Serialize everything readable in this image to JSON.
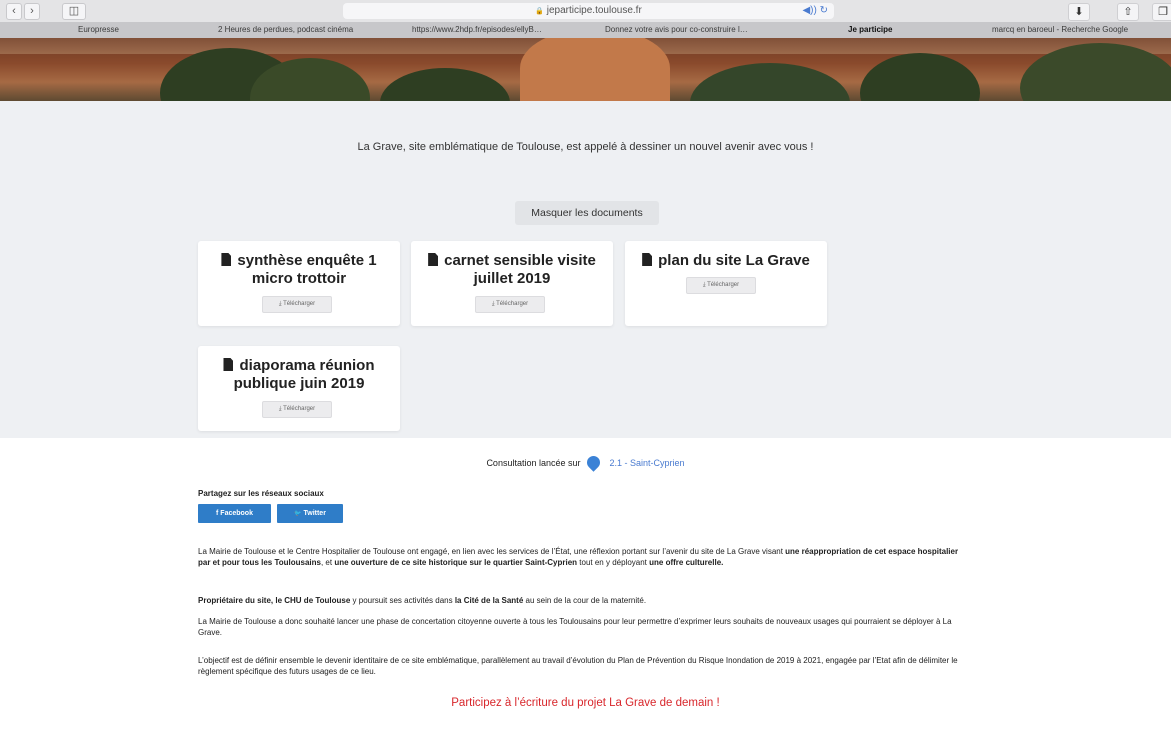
{
  "browser": {
    "nav_back": "‹",
    "nav_forward": "›",
    "sidebar_glyph": "◫",
    "url": "jeparticipe.toulouse.fr",
    "lock_glyph": "🔒",
    "audio_reload": "◀)) ↻",
    "download_glyph": "⬇",
    "share_glyph": "⇧",
    "tabs_glyph": "❐"
  },
  "favorites": [
    "Europresse",
    "2 Heures de perdues, podcast cinéma",
    "https://www.2hdp.fr/episodes/ellyB…",
    "Donnez votre avis pour co-construire l…",
    "Je participe",
    "marcq en baroeul - Recherche Google"
  ],
  "intro": "La Grave, site emblématique de Toulouse, est appelé à dessiner un nouvel avenir avec vous !",
  "toggle_label": "Masquer les documents",
  "documents": [
    {
      "title": "synthèse enquête 1 micro trottoir",
      "download": "Télécharger"
    },
    {
      "title": "carnet sensible visite juillet 2019",
      "download": "Télécharger"
    },
    {
      "title": "plan du site La Grave",
      "download": "Télécharger"
    },
    {
      "title": "diaporama réunion publique juin 2019",
      "download": "Télécharger"
    }
  ],
  "download_glyph": "⤓",
  "consultation": {
    "label": "Consultation lancée sur",
    "place": "2.1 - Saint-Cyprien"
  },
  "share": {
    "title": "Partagez sur les réseaux sociaux",
    "facebook": "Facebook",
    "twitter": "Twitter",
    "facebook_glyph": "f",
    "twitter_glyph": "🐦"
  },
  "paragraphs": {
    "p1a": "La Mairie de Toulouse et le Centre Hospitalier de Toulouse ont engagé, en lien avec les services de l’État, une réflexion portant sur l’avenir du site de La Grave visant ",
    "p1b": "une réappropriation de cet espace hospitalier par et pour tous les Toulousains",
    "p1c": ", et ",
    "p1d": "une ouverture de ce site historique sur le quartier Saint-Cyprien",
    "p1e": " tout en y déployant ",
    "p1f": "une offre culturelle.",
    "p2a": "Propriétaire du site, le CHU de Toulouse",
    "p2b": " y poursuit ses activités dans ",
    "p2c": "la Cité de la Santé",
    "p2d": " au sein de la cour de la maternité.",
    "p3": "La Mairie de Toulouse a donc souhaité lancer une phase de concertation citoyenne ouverte à tous les Toulousains pour leur permettre d’exprimer leurs souhaits de nouveaux usages qui pourraient se déployer à La Grave.",
    "p4": "L’objectif est de définir ensemble le devenir identitaire de ce site emblématique, parallèlement au travail d’évolution du Plan de Prévention du Risque Inondation de 2019 à 2021, engagée par l’Etat afin de délimiter le règlement spécifique des futurs usages de ce lieu."
  },
  "cta": "Participez à l’écriture du projet La Grave de demain !",
  "colors": {
    "accent_blue": "#2f7dc8",
    "cta_red": "#d8262b",
    "section_grey": "#eef0f3"
  }
}
